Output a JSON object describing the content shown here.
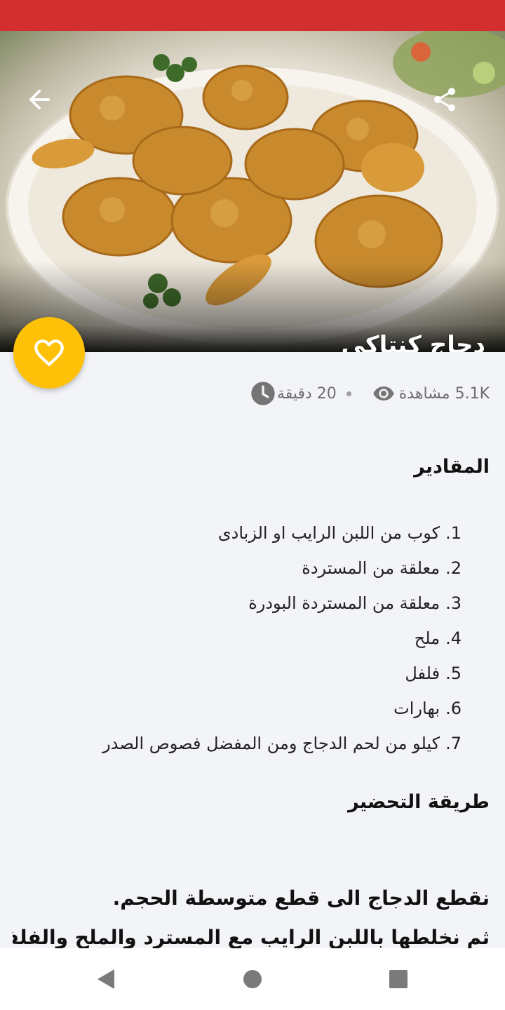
{
  "colors": {
    "status_bar": "#d32f2f",
    "favorite_button": "#ffc107",
    "background": "#f3f4f8",
    "meta_text": "#6f6f6f"
  },
  "header": {
    "back_icon": "arrow-left-icon",
    "share_icon": "share-icon",
    "title": "دجاج كنتاكي"
  },
  "favorite": {
    "icon": "heart-outline-icon"
  },
  "meta": {
    "time_icon": "clock-icon",
    "time_text": "20 دقيقة",
    "views_icon": "eye-icon",
    "views_text": "5.1K مشاهدة"
  },
  "ingredients": {
    "title": "المقادير",
    "items": [
      {
        "num": "1.",
        "text": "كوب من اللبن الرايب او الزبادى"
      },
      {
        "num": "2.",
        "text": "معلقة من المستردة"
      },
      {
        "num": "3.",
        "text": "معلقة من المستردة البودرة"
      },
      {
        "num": "4.",
        "text": "ملح"
      },
      {
        "num": "5.",
        "text": "فلفل"
      },
      {
        "num": "6.",
        "text": "بهارات"
      },
      {
        "num": "7.",
        "text": "كيلو من لحم الدجاج ومن المفضل فصوص الصدر"
      }
    ]
  },
  "preparation": {
    "title": "طريقة التحضير",
    "steps": [
      "نقطع الدجاج الى قطع متوسطة الحجم.",
      "ثم نخلطها باللبن الرايب مع المسترد والملح والفلفل"
    ]
  },
  "nav": {
    "back_icon": "nav-back-icon",
    "home_icon": "nav-home-icon",
    "recents_icon": "nav-recents-icon"
  }
}
